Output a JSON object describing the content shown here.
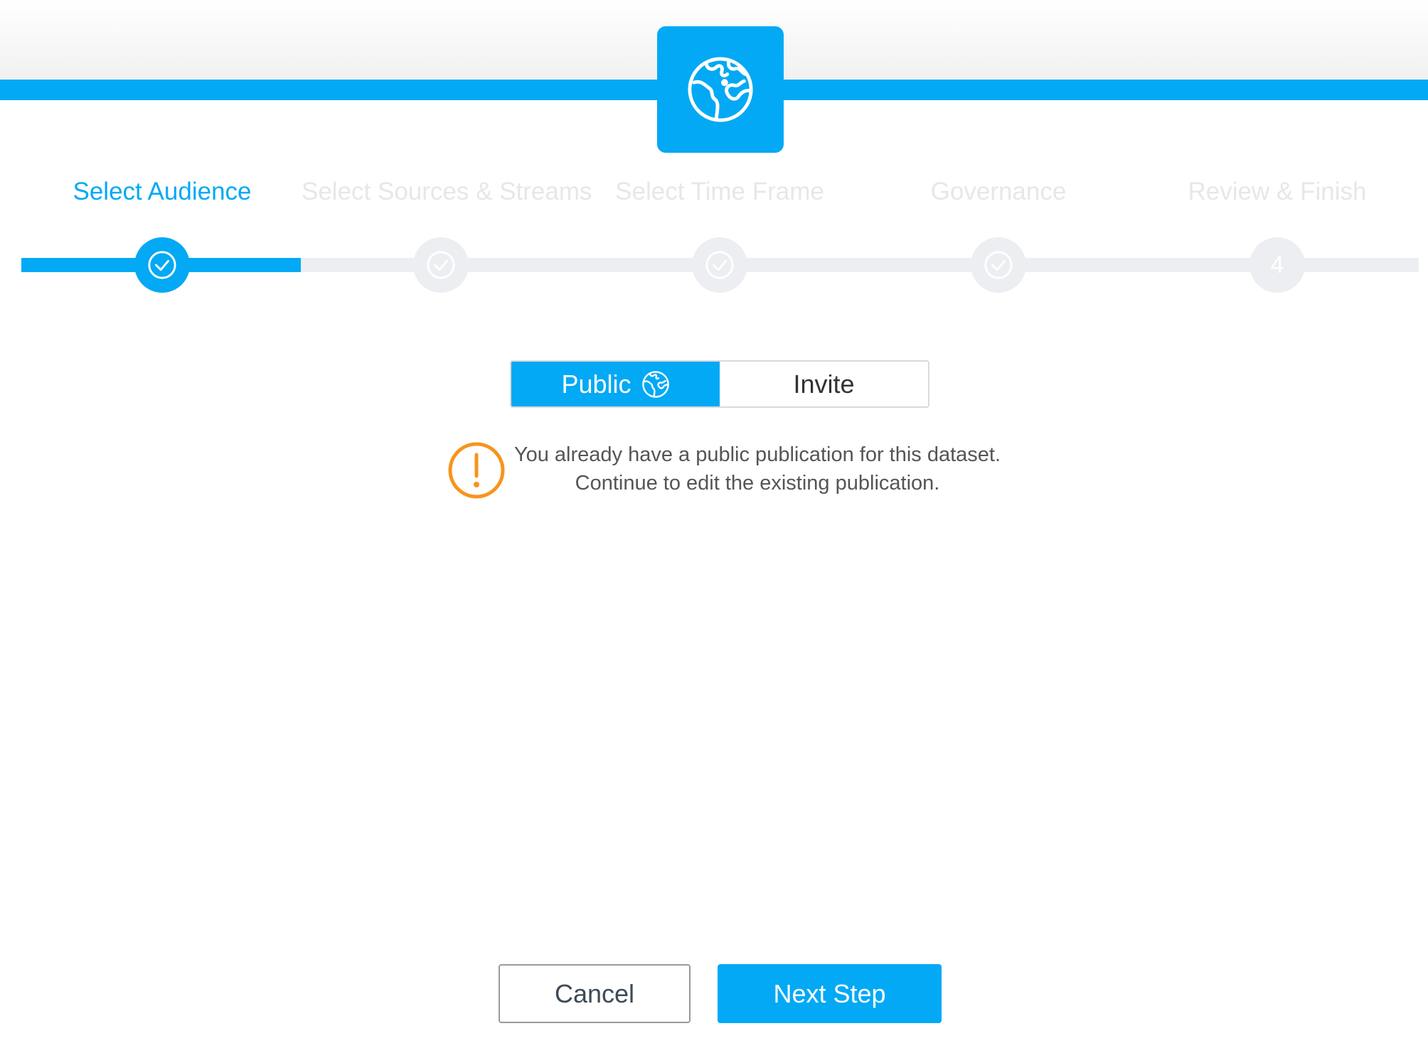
{
  "header": {
    "icon": "globe-icon",
    "accent_color": "#03a9f4"
  },
  "wizard": {
    "steps": [
      {
        "label": "Select Audience",
        "state": "active",
        "marker": "check-icon"
      },
      {
        "label": "Select Sources & Streams",
        "state": "inactive",
        "marker": "check-icon"
      },
      {
        "label": "Select Time Frame",
        "state": "inactive",
        "marker": "check-icon"
      },
      {
        "label": "Governance",
        "state": "inactive",
        "marker": "check-icon"
      },
      {
        "label": "Review & Finish",
        "state": "inactive",
        "marker": "4"
      }
    ]
  },
  "audience_toggle": {
    "public_label": "Public",
    "invite_label": "Invite",
    "selected": "Public"
  },
  "warning": {
    "icon": "warning-icon",
    "color": "#f7941d",
    "line1": "You already have a public publication for this dataset.",
    "line2": "Continue to edit the existing publication."
  },
  "footer": {
    "cancel_label": "Cancel",
    "next_label": "Next Step"
  }
}
